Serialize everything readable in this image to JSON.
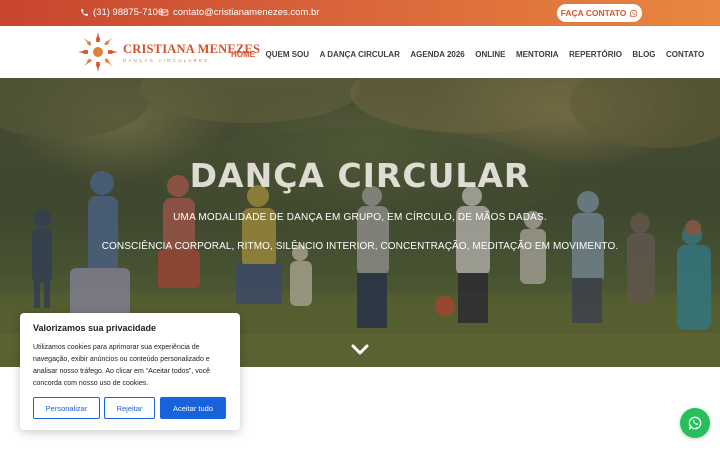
{
  "topbar": {
    "phone": "(31) 98875-7106",
    "email": "contato@cristianamenezes.com.br",
    "cta_label": "FAÇA CONTATO",
    "phone_icon": "phone-icon",
    "mail_icon": "mail-icon",
    "cta_icon": "whatsapp-icon"
  },
  "brand": {
    "name": "CRISTIANA MENEZES",
    "tagline": "DANÇAS CIRCULARES",
    "primary_color": "#d9572f",
    "logo_icon": "sun-dancers-icon"
  },
  "nav": {
    "items": [
      {
        "label": "HOME",
        "active": true
      },
      {
        "label": "QUEM SOU",
        "active": false
      },
      {
        "label": "A DANÇA CIRCULAR",
        "active": false
      },
      {
        "label": "AGENDA 2026",
        "active": false
      },
      {
        "label": "ONLINE",
        "active": false
      },
      {
        "label": "MENTORIA",
        "active": false
      },
      {
        "label": "REPERTÓRIO",
        "active": false
      },
      {
        "label": "BLOG",
        "active": false
      },
      {
        "label": "CONTATO",
        "active": false
      }
    ]
  },
  "hero": {
    "title": "DANÇA CIRCULAR",
    "subtitle1": "UMA MODALIDADE DE DANÇA EM GRUPO, EM CÍRCULO, DE MÃOS DADAS.",
    "subtitle2": "CONSCIÊNCIA CORPORAL, RITMO, SILÊNCIO INTERIOR, CONCENTRAÇÃO, MEDITAÇÃO EM MOVIMENTO.",
    "scroll_icon": "chevron-down-icon"
  },
  "cookie": {
    "title": "Valorizamos sua privacidade",
    "text": "Utilizamos cookies para aprimorar sua experiência de navegação, exibir anúncios ou conteúdo personalizado e analisar nosso tráfego. Ao clicar em “Aceitar todos”, você concorda com nosso uso de cookies.",
    "customize_label": "Personalizar",
    "reject_label": "Rejeitar",
    "accept_label": "Aceitar tudo",
    "button_color": "#1863dc"
  },
  "floating": {
    "whatsapp_icon": "whatsapp-icon",
    "color": "#25c05c"
  }
}
